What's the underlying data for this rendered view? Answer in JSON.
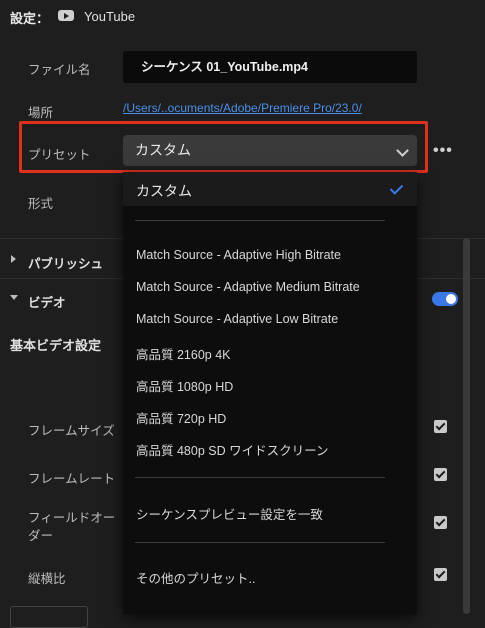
{
  "header": {
    "title": "設定：",
    "platform": "YouTube"
  },
  "fields": {
    "filename_label": "ファイル名",
    "filename_value": "シーケンス 01_YouTube.mp4",
    "location_label": "場所",
    "location_value": "/Users/..ocuments/Adobe/Premiere Pro/23.0/",
    "preset_label": "プリセット",
    "preset_value": "カスタム",
    "format_label": "形式"
  },
  "sections": {
    "publish": "パブリッシュ",
    "video": "ビデオ",
    "video_toggle_on": true,
    "basic_video": "基本ビデオ設定"
  },
  "video_settings": {
    "frame_size": "フレームサイズ",
    "frame_rate": "フレームレート",
    "field_order": "フィールドオー\nダー",
    "aspect": "縦横比"
  },
  "dropdown": {
    "selected": "カスタム",
    "items": [
      "Match Source - Adaptive High Bitrate",
      "Match Source - Adaptive Medium Bitrate",
      "Match Source - Adaptive Low Bitrate",
      "高品質 2160p 4K",
      "高品質 1080p HD",
      "高品質 720p HD",
      "高品質 480p SD ワイドスクリーン"
    ],
    "match_sequence": "シーケンスプレビュー設定を一致",
    "more_presets": "その他のプリセット.."
  },
  "colors": {
    "accent": "#3b78e7",
    "highlight": "#e0311f",
    "link": "#4b8fe8"
  }
}
